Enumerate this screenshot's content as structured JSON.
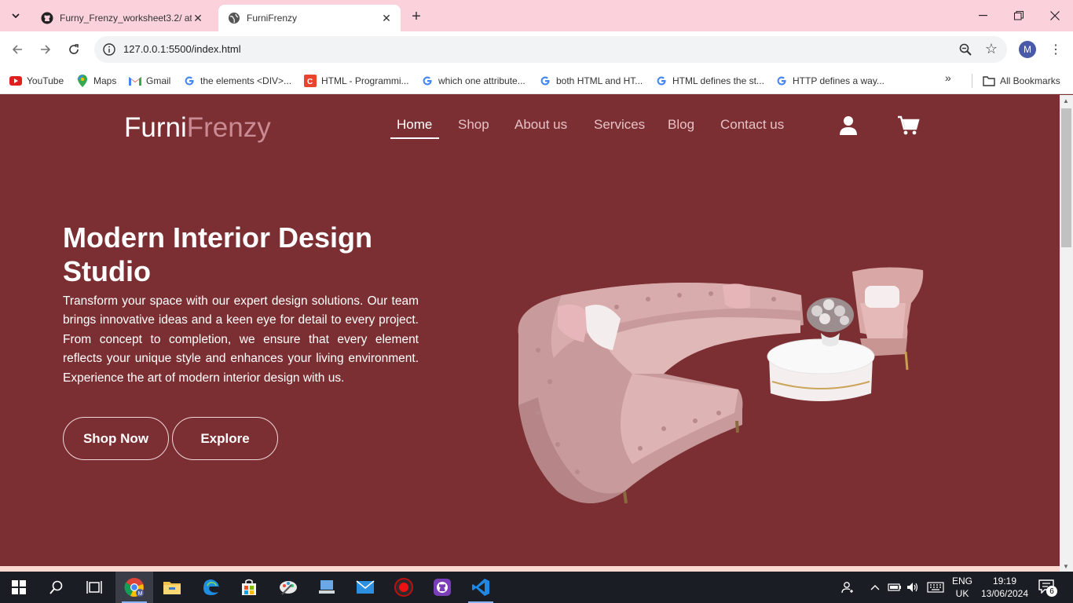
{
  "browser": {
    "tabs": [
      {
        "title": "Furny_Frenzy_worksheet3.2/ at",
        "icon": "github-icon"
      },
      {
        "title": "FurniFrenzy",
        "icon": "globe-icon"
      }
    ],
    "url": "127.0.0.1:5500/index.html",
    "profile_initial": "M",
    "bookmarks": [
      {
        "label": "YouTube",
        "icon": "youtube-icon"
      },
      {
        "label": "Maps",
        "icon": "maps-icon"
      },
      {
        "label": "Gmail",
        "icon": "gmail-icon"
      },
      {
        "label": "the elements <DIV>...",
        "icon": "google-icon"
      },
      {
        "label": "HTML - Programmi...",
        "icon": "chegg-icon"
      },
      {
        "label": "which one attribute...",
        "icon": "google-icon"
      },
      {
        "label": "both HTML and HT...",
        "icon": "google-icon"
      },
      {
        "label": "HTML defines the st...",
        "icon": "google-icon"
      },
      {
        "label": "HTTP defines a way...",
        "icon": "google-icon"
      }
    ],
    "all_bookmarks": "All Bookmarks"
  },
  "site": {
    "logo_part1": "Furni",
    "logo_part2": "Frenzy",
    "nav": [
      "Home",
      "Shop",
      "About us",
      "Services",
      "Blog",
      "Contact us"
    ],
    "active_nav": "Home",
    "hero": {
      "title": "Modern Interior Design Studio",
      "text": "Transform your space with our expert design solutions. Our team brings innovative ideas and a keen eye for detail to every project. From concept to completion, we ensure that every element reflects your unique style and enhances your living environment. Experience the art of modern interior design with us.",
      "btn_shop": "Shop Now",
      "btn_explore": "Explore"
    },
    "colors": {
      "background": "#7c2f32",
      "logo_accent": "#c98a94"
    }
  },
  "taskbar": {
    "lang_line1": "ENG",
    "lang_line2": "UK",
    "time": "19:19",
    "date": "13/06/2024",
    "notification_count": "6"
  }
}
